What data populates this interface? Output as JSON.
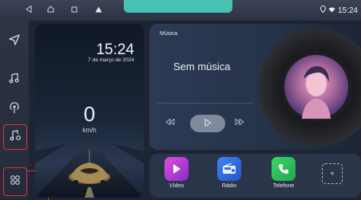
{
  "status_bar": {
    "back_icon": "back-triangle-icon",
    "home_icon": "home-icon",
    "recents_icon": "recents-square-icon",
    "notification_icon": "warning-triangle-icon",
    "time": "15:24",
    "accent_color": "#47c2b2"
  },
  "sidebar": {
    "items": [
      {
        "icon": "navigation-icon"
      },
      {
        "icon": "music-note-icon"
      },
      {
        "icon": "radio-signal-icon"
      },
      {
        "icon": "music-settings-icon"
      },
      {
        "icon": "apps-grid-icon"
      }
    ],
    "highlight_color": "#e0303b"
  },
  "clock": {
    "time": "15:24",
    "date": "7 de março de 2024"
  },
  "speedometer": {
    "speed": "0",
    "unit": "km/h"
  },
  "music": {
    "header": "Música",
    "track": "Sem música"
  },
  "apps": [
    {
      "label": "Vídeo",
      "icon": "video-play-icon",
      "color": "#d23bd1"
    },
    {
      "label": "Rádio",
      "icon": "radio-icon",
      "color": "#2f6de0"
    },
    {
      "label": "Telefone",
      "icon": "phone-icon",
      "color": "#2ec55a"
    }
  ]
}
